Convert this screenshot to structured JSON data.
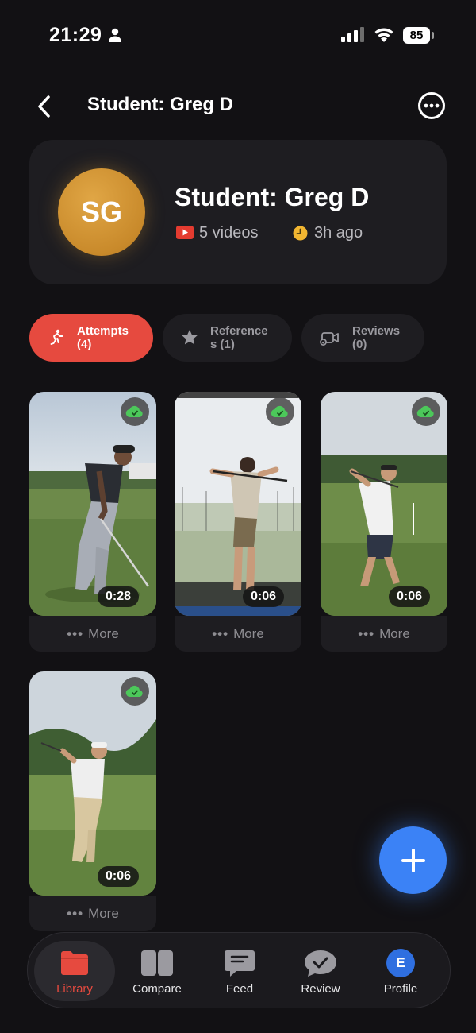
{
  "status_bar": {
    "time": "21:29",
    "battery": "85"
  },
  "header": {
    "title": "Student: Greg D"
  },
  "profile": {
    "initials": "SG",
    "name": "Student: Greg D",
    "video_count": "5 videos",
    "last_active": "3h ago",
    "avatar_color": "#d0952f"
  },
  "tabs": [
    {
      "label": "Attempts\n(4)",
      "icon": "running-person-icon",
      "active": true
    },
    {
      "label": "Reference\ns (1)",
      "icon": "star-icon",
      "active": false
    },
    {
      "label": "Reviews\n(0)",
      "icon": "video-review-icon",
      "active": false
    }
  ],
  "videos": [
    {
      "duration": "0:28",
      "more_label": "More",
      "synced": true
    },
    {
      "duration": "0:06",
      "more_label": "More",
      "synced": true
    },
    {
      "duration": "0:06",
      "more_label": "More",
      "synced": true
    },
    {
      "duration": "0:06",
      "more_label": "More",
      "synced": true
    }
  ],
  "bottom_nav": [
    {
      "label": "Library",
      "icon": "folder-icon",
      "active": true
    },
    {
      "label": "Compare",
      "icon": "compare-icon",
      "active": false
    },
    {
      "label": "Feed",
      "icon": "chat-bubble-icon",
      "active": false
    },
    {
      "label": "Review",
      "icon": "review-check-icon",
      "active": false
    },
    {
      "label": "Profile",
      "icon": "profile-avatar",
      "avatar_initial": "E",
      "active": false
    }
  ],
  "colors": {
    "accent": "#e64a3f",
    "fab": "#3b82f6",
    "background": "#121114",
    "card": "#1e1d21"
  }
}
